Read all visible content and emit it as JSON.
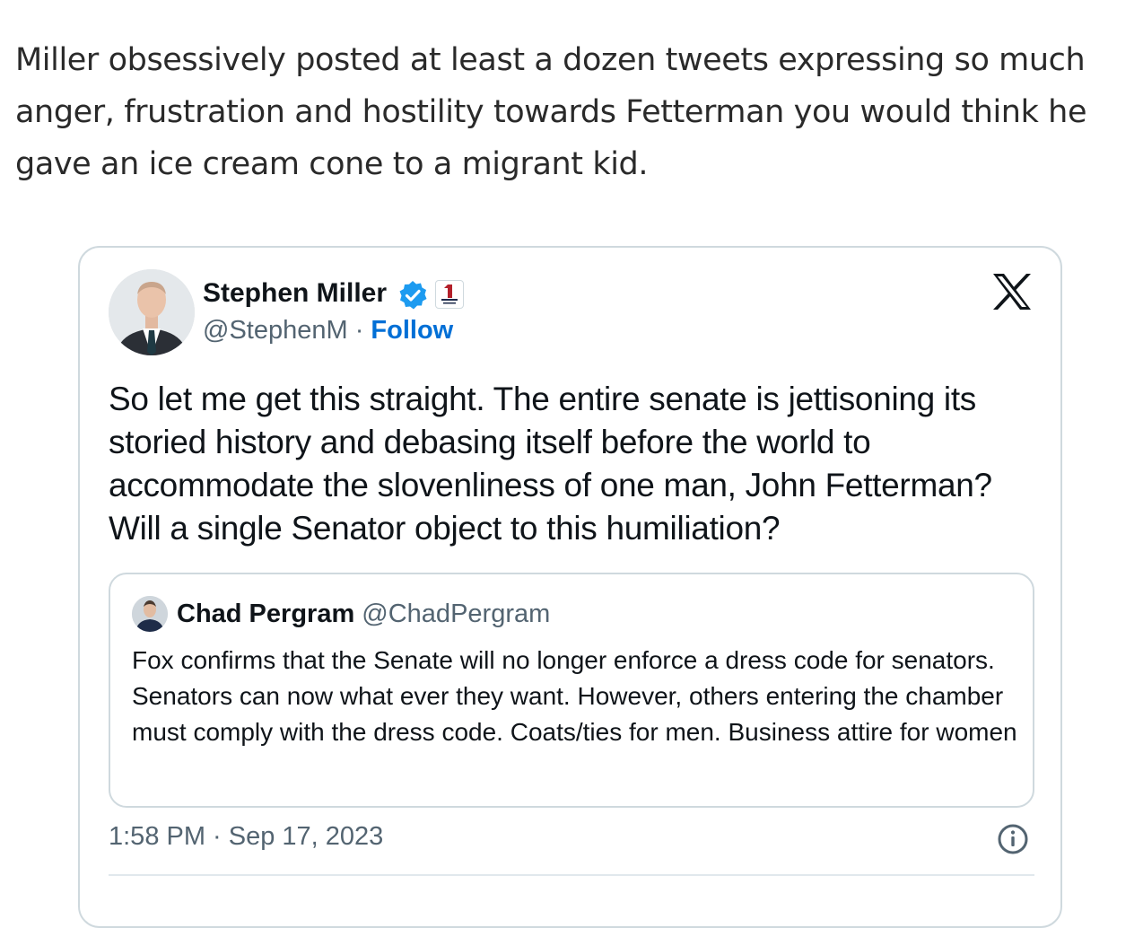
{
  "article": {
    "paragraph": "Miller obsessively posted at least a dozen tweets expressing so much anger, frustration and hostility towards Fetterman you would think he gave an ice cream cone to a migrant kid."
  },
  "tweet": {
    "author_name": "Stephen Miller",
    "handle": "@StephenM",
    "separator": " · ",
    "follow_label": "Follow",
    "text": "So let me get this straight. The entire senate is jettisoning its storied history and debasing itself before the world to accommodate the slovenliness of one man, John Fetterman? Will a single Senator object to this humiliation?",
    "timestamp": "1:58 PM · Sep 17, 2023",
    "quoted": {
      "author_name": "Chad Pergram",
      "handle": "@ChadPergram",
      "text": "Fox confirms that the Senate will no longer enforce a dress code for senators. Senators can now what ever they want. However, others entering the chamber must comply with the dress code. Coats/ties for men. Business attire for women"
    }
  },
  "icons": {
    "verified": "verified-badge-icon",
    "affiliation": "affiliation-badge-icon",
    "platform": "x-logo-icon",
    "info": "info-icon"
  },
  "colors": {
    "link": "#006fd6",
    "verified": "#1d9bf0",
    "secondary_text": "#536471",
    "border": "#cfd9de"
  }
}
